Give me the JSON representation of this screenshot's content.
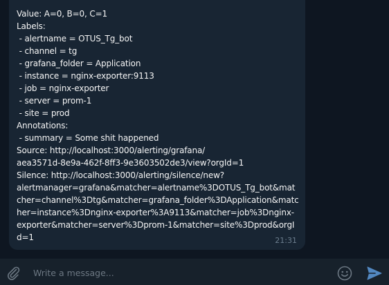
{
  "message": {
    "lines": [
      "Value: A=0, B=0, C=1",
      "Labels:",
      " - alertname = OTUS_Tg_bot",
      " - channel = tg",
      " - grafana_folder = Application",
      " - instance = nginx-exporter:9113",
      " - job = nginx-exporter",
      " - server = prom-1",
      " - site = prod",
      "Annotations:",
      " - summary = Some shit happened",
      "Source: http://localhost:3000/alerting/grafana/",
      "aea3571d-8e9a-462f-8ff3-9e3603502de3/view?orgId=1",
      "Silence: http://localhost:3000/alerting/silence/new?",
      "alertmanager=grafana&matcher=alertname%3DOTUS_Tg_bot&mat",
      "cher=channel%3Dtg&matcher=grafana_folder%3DApplication&matc",
      "her=instance%3Dnginx-exporter%3A9113&matcher=job%3Dnginx-",
      "exporter&matcher=server%3Dprom-1&matcher=site%3Dprod&orgI",
      "d=1"
    ],
    "time": "21:31"
  },
  "composer": {
    "placeholder": "Write a message...",
    "value": "",
    "attach_icon": "paperclip-icon",
    "emoji_icon": "smiley-icon",
    "send_icon": "send-arrow-icon"
  },
  "colors": {
    "chat_background": "#0e1621",
    "bubble": "#182533",
    "composer_background": "#17212b",
    "text": "#f5f5f5",
    "time": "#6d7f8f",
    "icon": "#6c7883",
    "send_accent": "#5288c1"
  }
}
